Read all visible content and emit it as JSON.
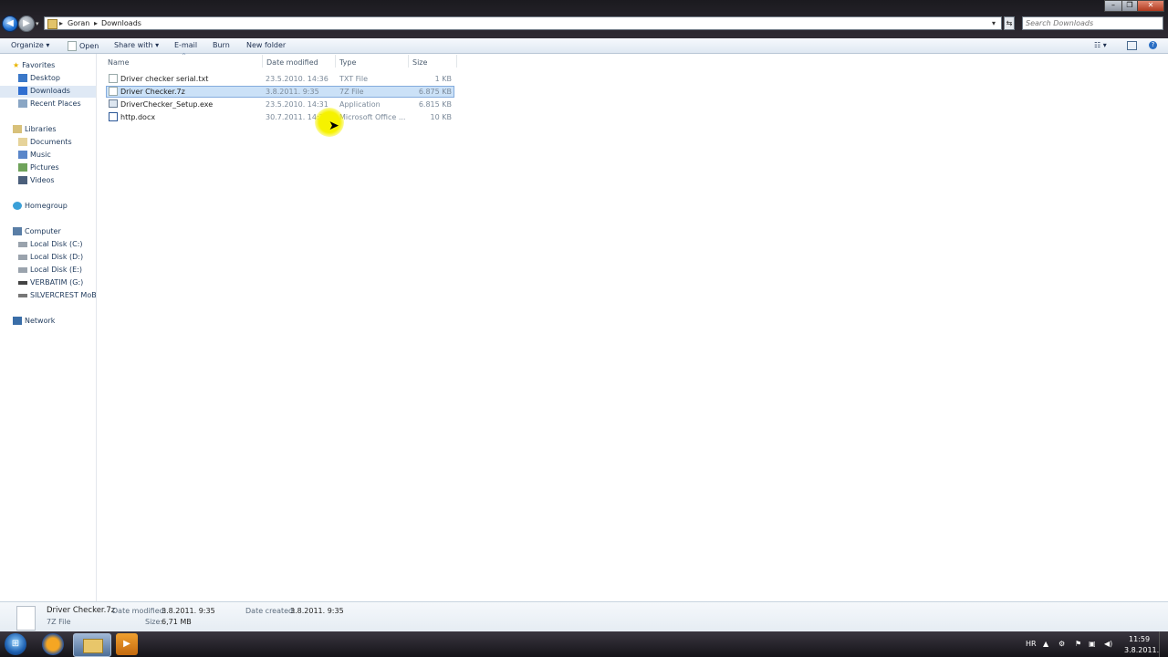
{
  "address": {
    "crumbs": [
      "Goran",
      "Downloads"
    ]
  },
  "search": {
    "placeholder": "Search Downloads"
  },
  "toolbar": {
    "organize": "Organize",
    "open": "Open",
    "share_with": "Share with",
    "email": "E-mail",
    "burn": "Burn",
    "new_folder": "New folder"
  },
  "sidebar": {
    "favorites": "Favorites",
    "favorites_items": [
      "Desktop",
      "Downloads",
      "Recent Places"
    ],
    "libraries": "Libraries",
    "library_items": [
      "Documents",
      "Music",
      "Pictures",
      "Videos"
    ],
    "homegroup": "Homegroup",
    "computer": "Computer",
    "computer_items": [
      "Local Disk (C:)",
      "Local Disk (D:)",
      "Local Disk (E:)",
      "VERBATIM (G:)",
      "SILVERCREST MoBo:"
    ],
    "network": "Network"
  },
  "columns": {
    "name": "Name",
    "date": "Date modified",
    "type": "Type",
    "size": "Size"
  },
  "files": [
    {
      "name": "Driver checker serial.txt",
      "date": "23.5.2010. 14:36",
      "type": "TXT File",
      "size": "1 KB"
    },
    {
      "name": "Driver Checker.7z",
      "date": "3.8.2011. 9:35",
      "type": "7Z File",
      "size": "6.875 KB"
    },
    {
      "name": "DriverChecker_Setup.exe",
      "date": "23.5.2010. 14:31",
      "type": "Application",
      "size": "6.815 KB"
    },
    {
      "name": "http.docx",
      "date": "30.7.2011. 14:21",
      "type": "Microsoft Office ...",
      "size": "10 KB"
    }
  ],
  "details": {
    "name": "Driver Checker.7z",
    "modified_label": "Date modified:",
    "modified": "3.8.2011. 9:35",
    "created_label": "Date created:",
    "created": "3.8.2011. 9:35",
    "type": "7Z File",
    "size_label": "Size:",
    "size": "6,71 MB"
  },
  "tray": {
    "lang": "HR",
    "time": "11:59",
    "date": "3.8.2011."
  }
}
